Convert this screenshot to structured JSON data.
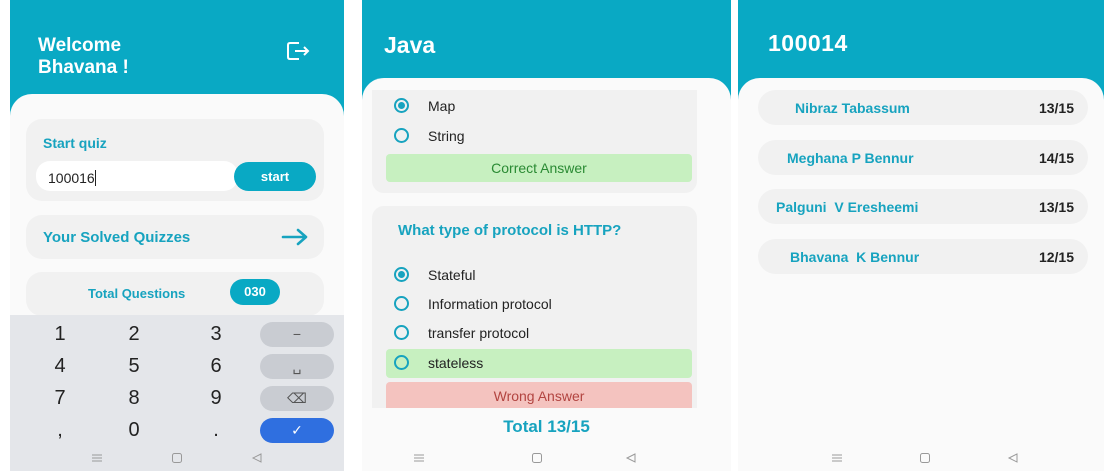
{
  "screen1": {
    "welcome_line1": "Welcome",
    "welcome_line2": "Bhavana !",
    "logout_icon": "logout-icon",
    "start_quiz_title": "Start quiz",
    "quiz_code_value": "100016",
    "start_button": "start",
    "solved_quizzes_label": "Your Solved Quizzes",
    "total_questions_label": "Total Questions",
    "total_questions_value": "030",
    "keypad": {
      "keys": [
        "1",
        "2",
        "3",
        "4",
        "5",
        "6",
        "7",
        "8",
        "9",
        ",",
        "0",
        "."
      ],
      "minus": "−",
      "space": "␣",
      "backspace": "⌫",
      "done": "✓"
    }
  },
  "screen2": {
    "title": "Java",
    "q1_options": [
      "Map",
      "String"
    ],
    "q1_selected": 0,
    "q1_result": "Correct Answer",
    "q2_text": "What type of protocol is HTTP?",
    "q2_options": [
      "Stateful",
      "Information protocol",
      "transfer protocol",
      "stateless"
    ],
    "q2_selected": 0,
    "q2_correct_option": 3,
    "q2_result": "Wrong Answer",
    "total": "Total 13/15"
  },
  "screen3": {
    "title": "100014",
    "results": [
      {
        "name": "Nibraz Tabassum",
        "score": "13/15"
      },
      {
        "name": "Meghana P Bennur",
        "score": "14/15"
      },
      {
        "name": "Palguni  V Eresheemi",
        "score": "13/15"
      },
      {
        "name": "Bhavana  K Bennur",
        "score": "12/15"
      }
    ]
  },
  "colors": {
    "header": "#09a9c4",
    "accent_text": "#17a3bf",
    "correct_bg": "#c7f0c0",
    "wrong_bg": "#f4c3bf",
    "keypad_done": "#2f6fe0"
  },
  "nav_icons": [
    "menu-icon",
    "home-icon",
    "back-icon"
  ]
}
